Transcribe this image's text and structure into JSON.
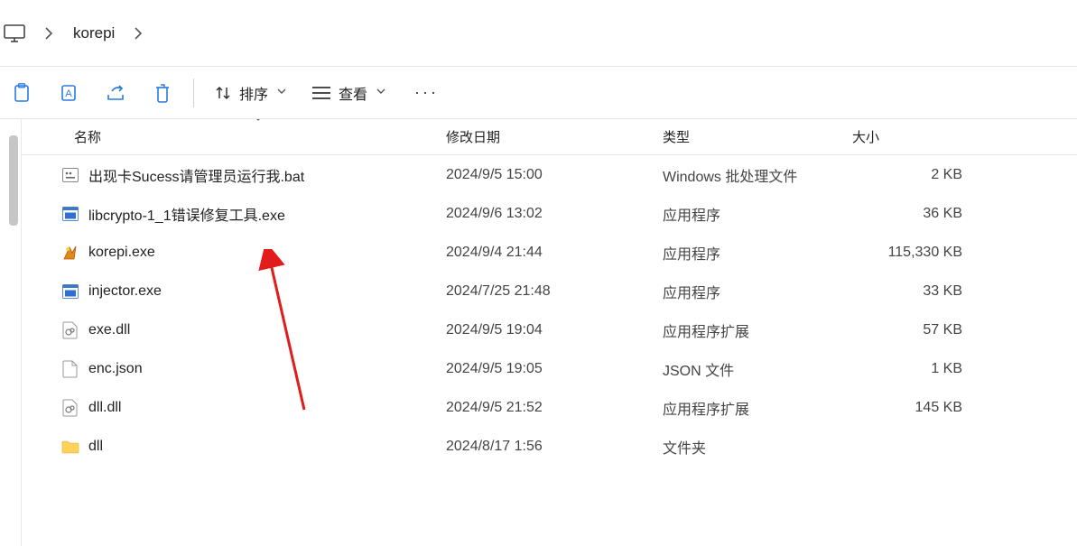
{
  "breadcrumb": {
    "folder": "korepi"
  },
  "toolbar": {
    "sort_label": "排序",
    "view_label": "查看"
  },
  "columns": {
    "name": "名称",
    "date": "修改日期",
    "type": "类型",
    "size": "大小"
  },
  "files": [
    {
      "icon": "bat",
      "name": "出现卡Sucess请管理员运行我.bat",
      "date": "2024/9/5 15:00",
      "type": "Windows 批处理文件",
      "size": "2 KB"
    },
    {
      "icon": "exe",
      "name": "libcrypto-1_1错误修复工具.exe",
      "date": "2024/9/6 13:02",
      "type": "应用程序",
      "size": "36 KB"
    },
    {
      "icon": "korepi",
      "name": "korepi.exe",
      "date": "2024/9/4 21:44",
      "type": "应用程序",
      "size": "115,330 KB"
    },
    {
      "icon": "exe",
      "name": "injector.exe",
      "date": "2024/7/25 21:48",
      "type": "应用程序",
      "size": "33 KB"
    },
    {
      "icon": "dll",
      "name": "exe.dll",
      "date": "2024/9/5 19:04",
      "type": "应用程序扩展",
      "size": "57 KB"
    },
    {
      "icon": "json",
      "name": "enc.json",
      "date": "2024/9/5 19:05",
      "type": "JSON 文件",
      "size": "1 KB"
    },
    {
      "icon": "dll",
      "name": "dll.dll",
      "date": "2024/9/5 21:52",
      "type": "应用程序扩展",
      "size": "145 KB"
    },
    {
      "icon": "folder",
      "name": "dll",
      "date": "2024/8/17 1:56",
      "type": "文件夹",
      "size": ""
    }
  ]
}
